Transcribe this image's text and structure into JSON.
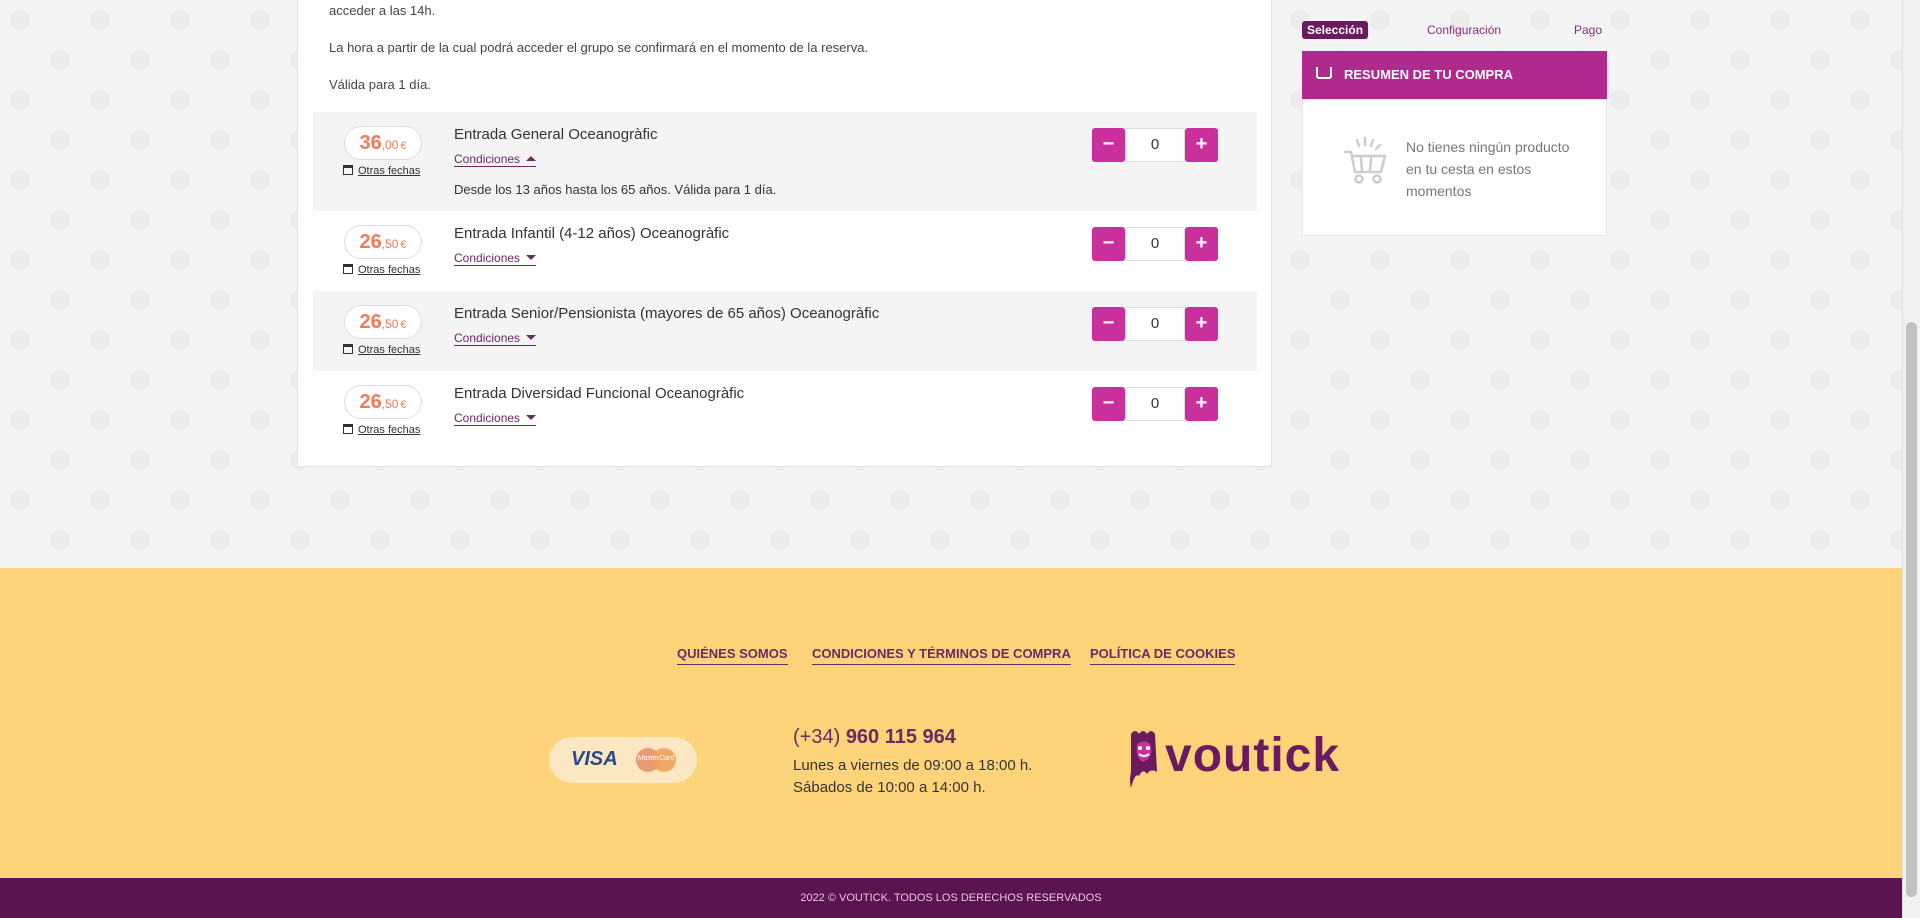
{
  "description": {
    "line1": "acceder a las 14h.",
    "line2": "La hora a partir de la cual podrá acceder el grupo se confirmará en el momento de la reserva.",
    "line3": "Válida para 1 día."
  },
  "tickets": [
    {
      "price_int": "36",
      "price_dec": ",00",
      "currency": "€",
      "other_dates": "Otras fechas",
      "name": "Entrada General Oceanogràfic",
      "conditions_label": "Condiciones",
      "conditions_text": "Desde los 13 años hasta los 65 años. Válida para 1 día.",
      "quantity": "0"
    },
    {
      "price_int": "26",
      "price_dec": ",50",
      "currency": "€",
      "other_dates": "Otras fechas",
      "name": "Entrada Infantil (4-12 años) Oceanogràfic",
      "conditions_label": "Condiciones",
      "quantity": "0"
    },
    {
      "price_int": "26",
      "price_dec": ",50",
      "currency": "€",
      "other_dates": "Otras fechas",
      "name": "Entrada Senior/Pensionista (mayores de 65 años) Oceanogràfic",
      "conditions_label": "Condiciones",
      "quantity": "0"
    },
    {
      "price_int": "26",
      "price_dec": ",50",
      "currency": "€",
      "other_dates": "Otras fechas",
      "name": "Entrada Diversidad Funcional Oceanogràfic",
      "conditions_label": "Condiciones",
      "quantity": "0"
    }
  ],
  "stepper": {
    "minus": "−",
    "plus": "+"
  },
  "steps": {
    "selection": "Selección",
    "configuration": "Configuración",
    "payment": "Pago"
  },
  "cart": {
    "title": "RESUMEN DE TU COMPRA",
    "empty_message": "No tienes ningún producto en tu cesta en estos momentos"
  },
  "footer": {
    "links": [
      "QUIÉNES SOMOS",
      "CONDICIONES Y TÉRMINOS DE COMPRA",
      "POLÍTICA DE COOKIES"
    ],
    "cards": {
      "visa": "VISA",
      "mastercard": "MasterCard"
    },
    "phone_prefix": "(+34)",
    "phone_number": "960 115 964",
    "hours_weekdays": "Lunes a viernes de 09:00 a 18:00 h.",
    "hours_saturday": "Sábados de 10:00 a 14:00 h.",
    "logo_text": "voutick",
    "copyright": "2022 © VOUTICK. TODOS LOS DERECHOS RESERVADOS"
  },
  "colors": {
    "brand_magenta": "#c9309c",
    "brand_purple": "#6a1a5e",
    "price_orange": "#f07b5a",
    "footer_yellow": "#fed47a"
  }
}
